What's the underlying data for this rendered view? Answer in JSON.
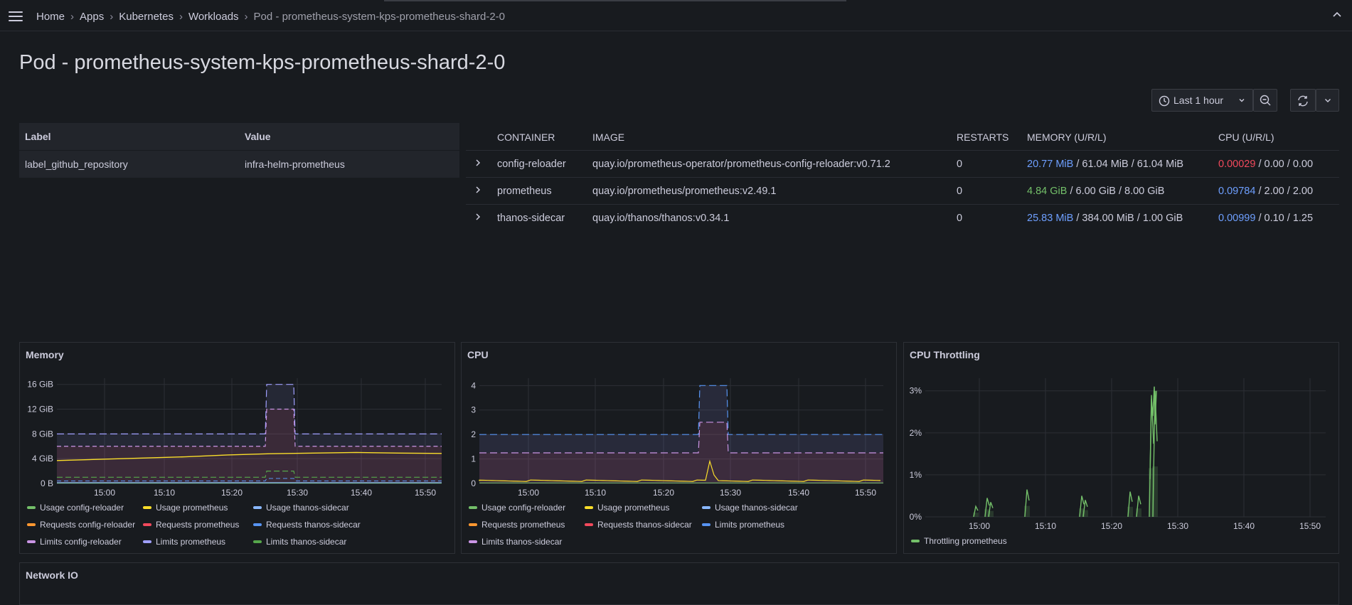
{
  "breadcrumb": {
    "items": [
      "Home",
      "Apps",
      "Kubernetes",
      "Workloads"
    ],
    "current": "Pod - prometheus-system-kps-prometheus-shard-2-0"
  },
  "page_title": "Pod - prometheus-system-kps-prometheus-shard-2-0",
  "time_picker": {
    "label": "Last 1 hour"
  },
  "labels_table": {
    "headers": [
      "Label",
      "Value"
    ],
    "rows": [
      [
        "label_github_repository",
        "infra-helm-prometheus"
      ]
    ]
  },
  "containers_table": {
    "headers": [
      "CONTAINER",
      "IMAGE",
      "RESTARTS",
      "MEMORY (U/R/L)",
      "CPU (U/R/L)"
    ],
    "rows": [
      {
        "container": "config-reloader",
        "image": "quay.io/prometheus-operator/prometheus-config-reloader:v0.71.2",
        "restarts": "0",
        "mem_usage": "20.77 MiB",
        "mem_rest": " / 61.04 MiB / 61.04 MiB",
        "cpu_usage": "0.00029",
        "cpu_rest": " / 0.00 / 0.00"
      },
      {
        "container": "prometheus",
        "image": "quay.io/prometheus/prometheus:v2.49.1",
        "restarts": "0",
        "mem_usage": "4.84 GiB",
        "mem_rest": " / 6.00 GiB / 8.00 GiB",
        "cpu_usage": "0.09784",
        "cpu_rest": " / 2.00 / 2.00"
      },
      {
        "container": "thanos-sidecar",
        "image": "quay.io/thanos/thanos:v0.34.1",
        "restarts": "0",
        "mem_usage": "25.83 MiB",
        "mem_rest": " / 384.00 MiB / 1.00 GiB",
        "cpu_usage": "0.00999",
        "cpu_rest": " / 0.10 / 1.25"
      }
    ]
  },
  "colors": {
    "green": "#73bf69",
    "yellow": "#fade2a",
    "blue": "#8ab8ff",
    "orange": "#ff9830",
    "red": "#f2495c",
    "lightblue": "#5794f2",
    "pink": "#ca95e5",
    "purple": "#a0a0ff",
    "darkgreen": "#56a64b"
  },
  "panels": {
    "memory": {
      "title": "Memory",
      "legend": [
        "Usage config-reloader",
        "Usage prometheus",
        "Usage thanos-sidecar",
        "Requests config-reloader",
        "Requests prometheus",
        "Requests thanos-sidecar",
        "Limits config-reloader",
        "Limits prometheus",
        "Limits thanos-sidecar"
      ]
    },
    "cpu": {
      "title": "CPU",
      "legend": [
        "Usage config-reloader",
        "Usage prometheus",
        "Usage thanos-sidecar",
        "Requests prometheus",
        "Requests thanos-sidecar",
        "Limits prometheus",
        "Limits thanos-sidecar"
      ]
    },
    "throttling": {
      "title": "CPU Throttling",
      "legend": [
        "Throttling prometheus"
      ]
    },
    "network": {
      "title": "Network IO"
    }
  },
  "chart_data": [
    {
      "type": "line",
      "title": "Memory",
      "x_ticks": [
        "15:00",
        "15:10",
        "15:20",
        "15:30",
        "15:40",
        "15:50"
      ],
      "y_ticks": [
        "0 B",
        "4 GiB",
        "8 GiB",
        "12 GiB",
        "16 GiB"
      ],
      "ylim_gib": [
        0,
        17
      ],
      "series": [
        {
          "name": "Limits prometheus",
          "values_gib": [
            8,
            8,
            8,
            8,
            16,
            16,
            8,
            8,
            8,
            8
          ]
        },
        {
          "name": "Requests prometheus",
          "values_gib": [
            6,
            6,
            6,
            6,
            12,
            12,
            6,
            6,
            6,
            6
          ]
        },
        {
          "name": "Usage prometheus",
          "values_gib": [
            3.7,
            3.9,
            4.1,
            4.3,
            4.6,
            4.8,
            4.9,
            5.0,
            4.9,
            4.85
          ]
        },
        {
          "name": "Limits thanos-sidecar",
          "values_gib": [
            1,
            1,
            1,
            1,
            2,
            2,
            1,
            1,
            1,
            1
          ]
        }
      ]
    },
    {
      "type": "line",
      "title": "CPU",
      "x_ticks": [
        "15:00",
        "15:10",
        "15:20",
        "15:30",
        "15:40",
        "15:50"
      ],
      "y_ticks": [
        "0",
        "1",
        "2",
        "3",
        "4"
      ],
      "ylim": [
        0,
        4.3
      ],
      "series": [
        {
          "name": "Limits prometheus",
          "values": [
            2,
            2,
            2,
            2,
            4,
            4,
            2,
            2,
            2,
            2
          ]
        },
        {
          "name": "Requests prometheus",
          "values": [
            1.25,
            1.25,
            1.25,
            1.25,
            2.5,
            2.5,
            1.25,
            1.25,
            1.25,
            1.25
          ]
        },
        {
          "name": "Usage prometheus",
          "values": [
            0.1,
            0.12,
            0.09,
            0.1,
            1.05,
            0.1,
            0.1,
            0.11,
            0.1,
            0.1
          ]
        }
      ]
    },
    {
      "type": "line",
      "title": "CPU Throttling",
      "x_ticks": [
        "15:00",
        "15:10",
        "15:20",
        "15:30",
        "15:40",
        "15:50"
      ],
      "y_ticks": [
        "0%",
        "1%",
        "2%",
        "3%"
      ],
      "ylim_pct": [
        0,
        3.3
      ],
      "series": [
        {
          "name": "Throttling prometheus",
          "values_pct": [
            0,
            0.25,
            0,
            0.45,
            0.65,
            0,
            0.5,
            0.6,
            0.7,
            3.0,
            0,
            0
          ]
        }
      ]
    }
  ]
}
